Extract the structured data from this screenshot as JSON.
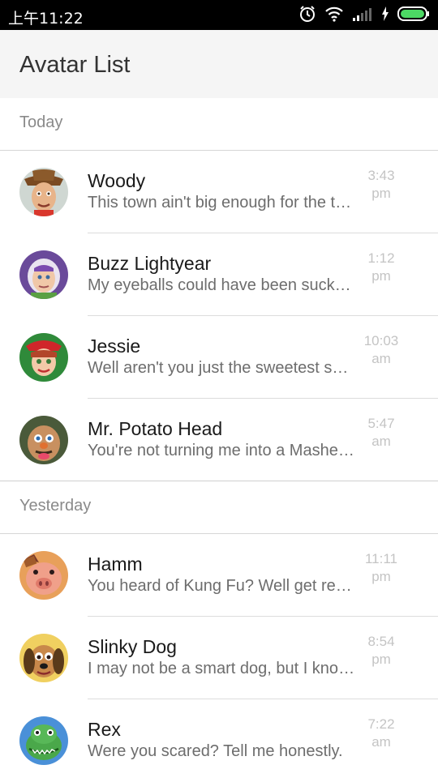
{
  "status_bar": {
    "time": "上午11:22"
  },
  "app_bar": {
    "title": "Avatar List"
  },
  "sections": [
    {
      "header": "Today"
    },
    {
      "header": "Yesterday"
    }
  ],
  "items": [
    {
      "name": "Woody",
      "message": "This town ain't big enough for the two of us!",
      "time_top": "3:43",
      "time_bottom": "pm",
      "avatar": "woody-avatar"
    },
    {
      "name": "Buzz Lightyear",
      "message": "My eyeballs could have been sucked from their sockets!",
      "time_top": "1:12",
      "time_bottom": "pm",
      "avatar": "buzz-avatar"
    },
    {
      "name": "Jessie",
      "message": "Well aren't you just the sweetest space toy I ever did meet!",
      "time_top": "10:03",
      "time_bottom": "am",
      "avatar": "jessie-avatar"
    },
    {
      "name": "Mr. Potato Head",
      "message": "You're not turning me into a Mashed Potato.",
      "time_top": "5:47",
      "time_bottom": "am",
      "avatar": "potato-avatar"
    },
    {
      "name": "Hamm",
      "message": "You heard of Kung Fu? Well get ready for pork chop.",
      "time_top": "11:11",
      "time_bottom": "pm",
      "avatar": "hamm-avatar"
    },
    {
      "name": "Slinky Dog",
      "message": "I may not be a smart dog, but I know what roadkill is.",
      "time_top": "8:54",
      "time_bottom": "pm",
      "avatar": "slinky-avatar"
    },
    {
      "name": "Rex",
      "message": "Were you scared? Tell me honestly.",
      "time_top": "7:22",
      "time_bottom": "am",
      "avatar": "rex-avatar"
    }
  ]
}
